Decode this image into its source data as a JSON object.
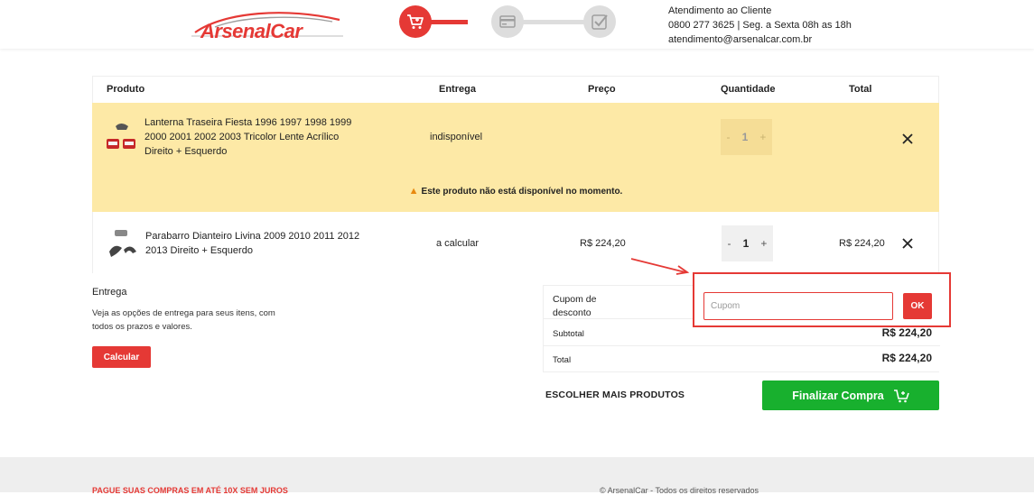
{
  "brand": {
    "logo_text": "ArsenalCar",
    "accent": "#e53935",
    "success": "#18b02e"
  },
  "steps": [
    {
      "name": "cart",
      "icon": "cart-icon",
      "active": true
    },
    {
      "name": "payment",
      "icon": "card-icon",
      "active": false
    },
    {
      "name": "confirm",
      "icon": "check-icon",
      "active": false
    }
  ],
  "support": {
    "title": "Atendimento ao Cliente",
    "phone_hours": "0800 277 3625 | Seg. a Sexta 08h as 18h",
    "email": "atendimento@arsenalcar.com.br"
  },
  "cart": {
    "headers": {
      "product": "Produto",
      "delivery": "Entrega",
      "price": "Preço",
      "quantity": "Quantidade",
      "total": "Total"
    },
    "items": [
      {
        "name": "Lanterna Traseira Fiesta 1996 1997 1998 1999 2000 2001 2002 2003 Tricolor Lente Acrílico Direito + Esquerdo",
        "delivery": "indisponível",
        "price": "",
        "quantity": "1",
        "total": "",
        "available": false,
        "warning": "Este produto não está disponível no momento."
      },
      {
        "name": "Parabarro Dianteiro Livina 2009 2010 2011 2012 2013 Direito + Esquerdo",
        "delivery": "a calcular",
        "price": "R$ 224,20",
        "quantity": "1",
        "total": "R$ 224,20",
        "available": true
      }
    ],
    "qty_minus": "-",
    "qty_plus": "+"
  },
  "delivery": {
    "title": "Entrega",
    "text": "Veja as opções de entrega para seus itens, com todos os prazos e valores.",
    "calc_label": "Calcular"
  },
  "summary": {
    "coupon_label": "Cupom de desconto",
    "coupon_placeholder": "Cupom",
    "coupon_value": "",
    "ok_label": "OK",
    "subtotal_label": "Subtotal",
    "subtotal_value": "R$ 224,20",
    "total_label": "Total",
    "total_value": "R$ 224,20"
  },
  "actions": {
    "more_products": "ESCOLHER MAIS PRODUTOS",
    "finish": "Finalizar Compra"
  },
  "footer": {
    "promo": "PAGUE SUAS COMPRAS EM ATÉ 10X SEM JUROS",
    "copyright": "© ArsenalCar - Todos os direitos reservados"
  }
}
